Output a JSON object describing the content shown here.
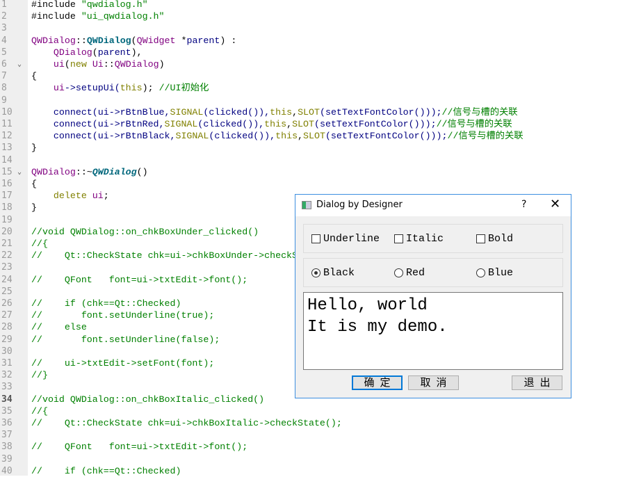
{
  "editor": {
    "current_line": 34,
    "fold_lines": [
      6,
      15
    ],
    "lines": [
      [
        {
          "c": "o",
          "t": "#include "
        },
        {
          "c": "s",
          "t": "\"qwdialog.h\""
        }
      ],
      [
        {
          "c": "o",
          "t": "#include "
        },
        {
          "c": "s",
          "t": "\"ui_qwdialog.h\""
        }
      ],
      [],
      [
        {
          "c": "p",
          "t": "QWDialog"
        },
        {
          "c": "o",
          "t": "::"
        },
        {
          "c": "b",
          "t": "QWDialog"
        },
        {
          "c": "o",
          "t": "("
        },
        {
          "c": "p",
          "t": "QWidget"
        },
        {
          "c": "o",
          "t": " *"
        },
        {
          "c": "n",
          "t": "parent"
        },
        {
          "c": "o",
          "t": ") :"
        }
      ],
      [
        {
          "c": "o",
          "t": "    "
        },
        {
          "c": "p",
          "t": "QDialog"
        },
        {
          "c": "o",
          "t": "("
        },
        {
          "c": "n",
          "t": "parent"
        },
        {
          "c": "o",
          "t": "),"
        }
      ],
      [
        {
          "c": "o",
          "t": "    "
        },
        {
          "c": "p",
          "t": "ui"
        },
        {
          "c": "o",
          "t": "("
        },
        {
          "c": "k",
          "t": "new"
        },
        {
          "c": "o",
          "t": " "
        },
        {
          "c": "p",
          "t": "Ui"
        },
        {
          "c": "o",
          "t": "::"
        },
        {
          "c": "p",
          "t": "QWDialog"
        },
        {
          "c": "o",
          "t": ")"
        }
      ],
      [
        {
          "c": "o",
          "t": "{"
        }
      ],
      [
        {
          "c": "o",
          "t": "    "
        },
        {
          "c": "p",
          "t": "ui"
        },
        {
          "c": "n",
          "t": "->setupUi("
        },
        {
          "c": "k",
          "t": "this"
        },
        {
          "c": "o",
          "t": "); "
        },
        {
          "c": "c",
          "t": "//UI初始化"
        }
      ],
      [],
      [
        {
          "c": "n",
          "t": "    connect(ui->rBtnBlue,"
        },
        {
          "c": "k",
          "t": "SIGNAL"
        },
        {
          "c": "n",
          "t": "(clicked()),"
        },
        {
          "c": "k",
          "t": "this"
        },
        {
          "c": "o",
          "t": ","
        },
        {
          "c": "k",
          "t": "SLOT"
        },
        {
          "c": "n",
          "t": "(setTextFontColor()));"
        },
        {
          "c": "c",
          "t": "//信号与槽的关联"
        }
      ],
      [
        {
          "c": "n",
          "t": "    connect(ui->rBtnRed,"
        },
        {
          "c": "k",
          "t": "SIGNAL"
        },
        {
          "c": "n",
          "t": "(clicked()),"
        },
        {
          "c": "k",
          "t": "this"
        },
        {
          "c": "o",
          "t": ","
        },
        {
          "c": "k",
          "t": "SLOT"
        },
        {
          "c": "n",
          "t": "(setTextFontColor()));"
        },
        {
          "c": "c",
          "t": "//信号与槽的关联"
        }
      ],
      [
        {
          "c": "n",
          "t": "    connect(ui->rBtnBlack,"
        },
        {
          "c": "k",
          "t": "SIGNAL"
        },
        {
          "c": "n",
          "t": "(clicked()),"
        },
        {
          "c": "k",
          "t": "this"
        },
        {
          "c": "o",
          "t": ","
        },
        {
          "c": "k",
          "t": "SLOT"
        },
        {
          "c": "n",
          "t": "(setTextFontColor()));"
        },
        {
          "c": "c",
          "t": "//信号与槽的关联"
        }
      ],
      [
        {
          "c": "o",
          "t": "}"
        }
      ],
      [],
      [
        {
          "c": "p",
          "t": "QWDialog"
        },
        {
          "c": "o",
          "t": "::~"
        },
        {
          "c": "bi",
          "t": "QWDialog"
        },
        {
          "c": "o",
          "t": "()"
        }
      ],
      [
        {
          "c": "o",
          "t": "{"
        }
      ],
      [
        {
          "c": "o",
          "t": "    "
        },
        {
          "c": "k",
          "t": "delete"
        },
        {
          "c": "o",
          "t": " "
        },
        {
          "c": "p",
          "t": "ui"
        },
        {
          "c": "o",
          "t": ";"
        }
      ],
      [
        {
          "c": "o",
          "t": "}"
        }
      ],
      [],
      [
        {
          "c": "c",
          "t": "//void QWDialog::on_chkBoxUnder_clicked()"
        }
      ],
      [
        {
          "c": "c",
          "t": "//{"
        }
      ],
      [
        {
          "c": "c",
          "t": "//    Qt::CheckState chk=ui->chkBoxUnder->checkState();"
        }
      ],
      [],
      [
        {
          "c": "c",
          "t": "//    QFont   font=ui->txtEdit->font();"
        }
      ],
      [],
      [
        {
          "c": "c",
          "t": "//    if (chk==Qt::Checked)"
        }
      ],
      [
        {
          "c": "c",
          "t": "//       font.setUnderline(true);"
        }
      ],
      [
        {
          "c": "c",
          "t": "//    else"
        }
      ],
      [
        {
          "c": "c",
          "t": "//       font.setUnderline(false);"
        }
      ],
      [],
      [
        {
          "c": "c",
          "t": "//    ui->txtEdit->setFont(font);"
        }
      ],
      [
        {
          "c": "c",
          "t": "//}"
        }
      ],
      [],
      [
        {
          "c": "c",
          "t": "//void QWDialog::on_chkBoxItalic_clicked()"
        }
      ],
      [
        {
          "c": "c",
          "t": "//{"
        }
      ],
      [
        {
          "c": "c",
          "t": "//    Qt::CheckState chk=ui->chkBoxItalic->checkState();"
        }
      ],
      [],
      [
        {
          "c": "c",
          "t": "//    QFont   font=ui->txtEdit->font();"
        }
      ],
      [],
      [
        {
          "c": "c",
          "t": "//    if (chk==Qt::Checked)"
        }
      ]
    ]
  },
  "dialog": {
    "title": "Dialog by Designer",
    "help": "?",
    "close": "✕",
    "checkboxes": [
      {
        "label": "Underline",
        "checked": false
      },
      {
        "label": "Italic",
        "checked": false
      },
      {
        "label": "Bold",
        "checked": false
      }
    ],
    "radios": [
      {
        "label": "Black",
        "checked": true
      },
      {
        "label": "Red",
        "checked": false
      },
      {
        "label": "Blue",
        "checked": false
      }
    ],
    "text": [
      "Hello, world",
      "It is my demo."
    ],
    "buttons": {
      "ok": "确定",
      "cancel": "取消",
      "quit": "退出"
    }
  }
}
